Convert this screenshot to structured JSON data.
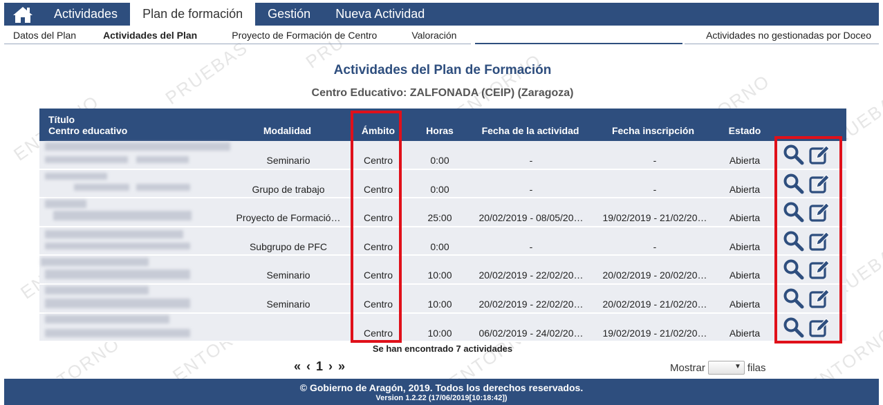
{
  "nav": {
    "home_icon": "home-icon",
    "tabs": [
      "Actividades",
      "Plan de formación",
      "Gestión",
      "Nueva Actividad"
    ]
  },
  "subnav": {
    "items": [
      "Datos del Plan",
      "Actividades del Plan",
      "Proyecto de Formación de Centro",
      "Valoración"
    ],
    "right": "Actividades no gestionadas por Doceo"
  },
  "page": {
    "title": "Actividades del Plan de Formación",
    "subtitle": "Centro Educativo: ZALFONADA (CEIP) (Zaragoza)"
  },
  "table": {
    "headers": {
      "titulo": "Título",
      "centro": "Centro educativo",
      "modalidad": "Modalidad",
      "ambito": "Ámbito",
      "horas": "Horas",
      "fecha_actividad": "Fecha de la actividad",
      "fecha_inscripcion": "Fecha inscripción",
      "estado": "Estado"
    },
    "rows": [
      {
        "modalidad": "Seminario",
        "ambito": "Centro",
        "horas": "0:00",
        "fecha_actividad": "-",
        "fecha_inscripcion": "-",
        "estado": "Abierta"
      },
      {
        "modalidad": "Grupo de trabajo",
        "ambito": "Centro",
        "horas": "0:00",
        "fecha_actividad": "-",
        "fecha_inscripcion": "-",
        "estado": "Abierta"
      },
      {
        "modalidad": "Proyecto de Formació…",
        "ambito": "Centro",
        "horas": "25:00",
        "fecha_actividad": "20/02/2019 - 08/05/20…",
        "fecha_inscripcion": "19/02/2019 - 21/02/20…",
        "estado": "Abierta"
      },
      {
        "modalidad": "Subgrupo de PFC",
        "ambito": "Centro",
        "horas": "0:00",
        "fecha_actividad": "-",
        "fecha_inscripcion": "-",
        "estado": "Abierta"
      },
      {
        "modalidad": "Seminario",
        "ambito": "Centro",
        "horas": "10:00",
        "fecha_actividad": "20/02/2019 - 22/02/20…",
        "fecha_inscripcion": "20/02/2019 - 20/02/20…",
        "estado": "Abierta"
      },
      {
        "modalidad": "Seminario",
        "ambito": "Centro",
        "horas": "10:00",
        "fecha_actividad": "20/02/2019 - 22/02/20…",
        "fecha_inscripcion": "20/02/2019 - 21/02/20…",
        "estado": "Abierta"
      },
      {
        "modalidad": "",
        "ambito": "Centro",
        "horas": "10:00",
        "fecha_actividad": "06/02/2019 - 24/02/20…",
        "fecha_inscripcion": "19/02/2019 - 21/02/20…",
        "estado": "Abierta"
      }
    ],
    "action_icons": [
      "search-icon",
      "edit-icon"
    ]
  },
  "results_text": "Se han encontrado 7 actividades",
  "pager": {
    "first": "«",
    "prev": "‹",
    "page": "1",
    "next": "›",
    "last": "»"
  },
  "rows_select": {
    "label_before": "Mostrar",
    "label_after": "filas",
    "value": ""
  },
  "footer": {
    "copyright": "© Gobierno de Aragón, 2019. Todos los derechos reservados.",
    "version": "Version 1.2.22 (17/06/2019[10:18:42])"
  },
  "colors": {
    "primary": "#2e4e7e",
    "row_bg": "#ebedf2",
    "highlight": "#e0101a"
  }
}
